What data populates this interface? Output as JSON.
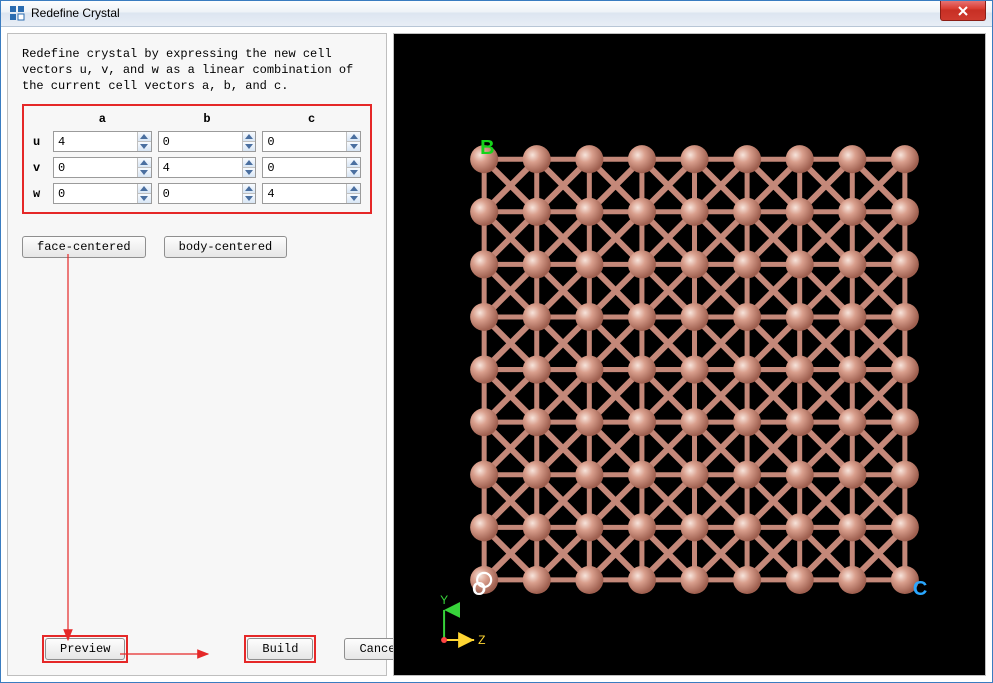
{
  "window": {
    "title": "Redefine Crystal"
  },
  "description": "Redefine crystal by expressing the new  cell vectors u, v, and w as a linear combination of the current cell vectors a, b,  and c.",
  "matrix": {
    "cols": [
      "a",
      "b",
      "c"
    ],
    "rows": [
      "u",
      "v",
      "w"
    ],
    "values": {
      "u": {
        "a": "4",
        "b": "0",
        "c": "0"
      },
      "v": {
        "a": "0",
        "b": "4",
        "c": "0"
      },
      "w": {
        "a": "0",
        "b": "0",
        "c": "4"
      }
    }
  },
  "buttons": {
    "face_centered": "face-centered",
    "body_centered": "body-centered",
    "preview": "Preview",
    "build": "Build",
    "cancel": "Cancel"
  },
  "viewport": {
    "origin_label": "O",
    "axis_b": "B",
    "axis_c": "C",
    "small_y": "Y",
    "small_z": "Z",
    "atom_color": "#c98a7a",
    "atom_spec": "#f2d6cc",
    "bond_color": "#c48879"
  }
}
